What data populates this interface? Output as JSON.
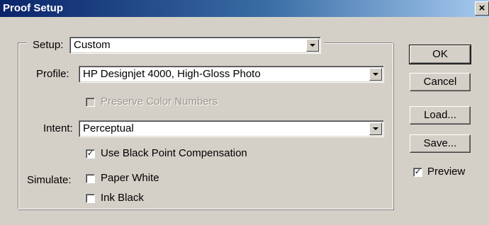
{
  "window": {
    "title": "Proof Setup",
    "close_glyph": "×"
  },
  "setup": {
    "label": "Setup:",
    "value": "Custom"
  },
  "profile": {
    "label": "Profile:",
    "value": "HP Designjet 4000, High-Gloss Photo"
  },
  "preserve_color_numbers": {
    "label": "Preserve Color Numbers",
    "checked": false,
    "enabled": false
  },
  "intent": {
    "label": "Intent:",
    "value": "Perceptual"
  },
  "black_point": {
    "label": "Use Black Point Compensation",
    "checked": true
  },
  "simulate": {
    "label": "Simulate:",
    "paper_white": {
      "label": "Paper White",
      "checked": false
    },
    "ink_black": {
      "label": "Ink Black",
      "checked": false
    }
  },
  "buttons": {
    "ok": "OK",
    "cancel": "Cancel",
    "load": "Load...",
    "save": "Save..."
  },
  "preview": {
    "label": "Preview",
    "checked": true
  },
  "check_glyph": "✓"
}
